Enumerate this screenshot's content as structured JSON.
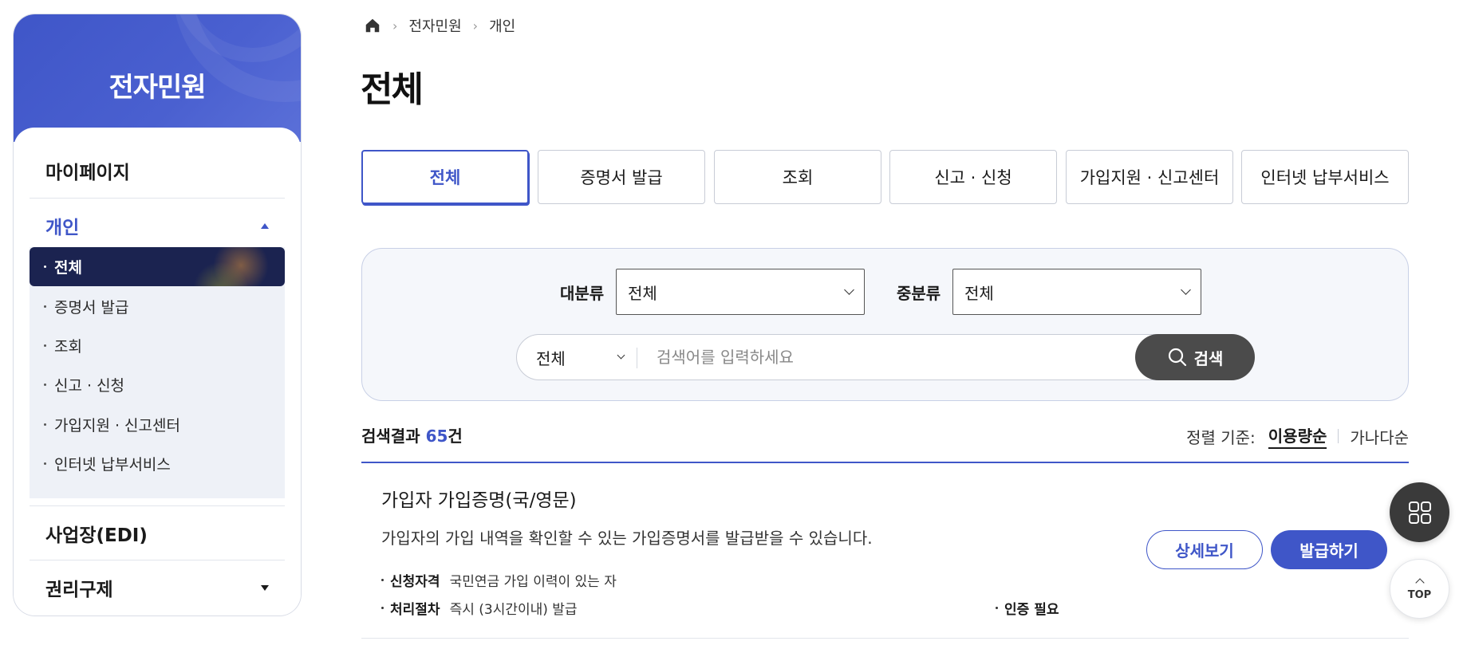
{
  "sidebar": {
    "title": "전자민원",
    "menu": {
      "mypage": "마이페이지",
      "personal": "개인",
      "business": "사업장(EDI)",
      "rights": "권리구제"
    },
    "submenu": [
      "전체",
      "증명서 발급",
      "조회",
      "신고 · 신청",
      "가입지원 · 신고센터",
      "인터넷 납부서비스"
    ],
    "active_submenu": "전체"
  },
  "breadcrumb": {
    "items": [
      "전자민원",
      "개인"
    ]
  },
  "page": {
    "title": "전체"
  },
  "tabs": [
    "전체",
    "증명서 발급",
    "조회",
    "신고 · 신청",
    "가입지원 · 신고센터",
    "인터넷 납부서비스"
  ],
  "active_tab": "전체",
  "filters": {
    "major_label": "대분류",
    "major_value": "전체",
    "middle_label": "중분류",
    "middle_value": "전체"
  },
  "search": {
    "type_value": "전체",
    "placeholder": "검색어를 입력하세요",
    "button": "검색"
  },
  "results": {
    "prefix": "검색결과 ",
    "count": "65",
    "suffix": "건",
    "sort_label": "정렬 기준:",
    "sort_options": [
      "이용량순",
      "가나다순"
    ],
    "active_sort": "이용량순"
  },
  "items": [
    {
      "title": "가입자 가입증명(국/영문)",
      "description": "가입자의 가입 내역을 확인할 수 있는 가입증명서를 발급받을 수 있습니다.",
      "eligibility_key": "신청자격",
      "eligibility_value": "국민연금 가입 이력이 있는 자",
      "process_key": "처리절차",
      "process_value": "즉시 (3시간이내) 발급",
      "auth": "인증 필요",
      "detail_button": "상세보기",
      "issue_button": "발급하기"
    }
  ],
  "floating": {
    "top_label": "TOP"
  },
  "colors": {
    "primary": "#3f56c8",
    "sidebar_active": "#1b2350",
    "search_button": "#4b4b4b"
  }
}
